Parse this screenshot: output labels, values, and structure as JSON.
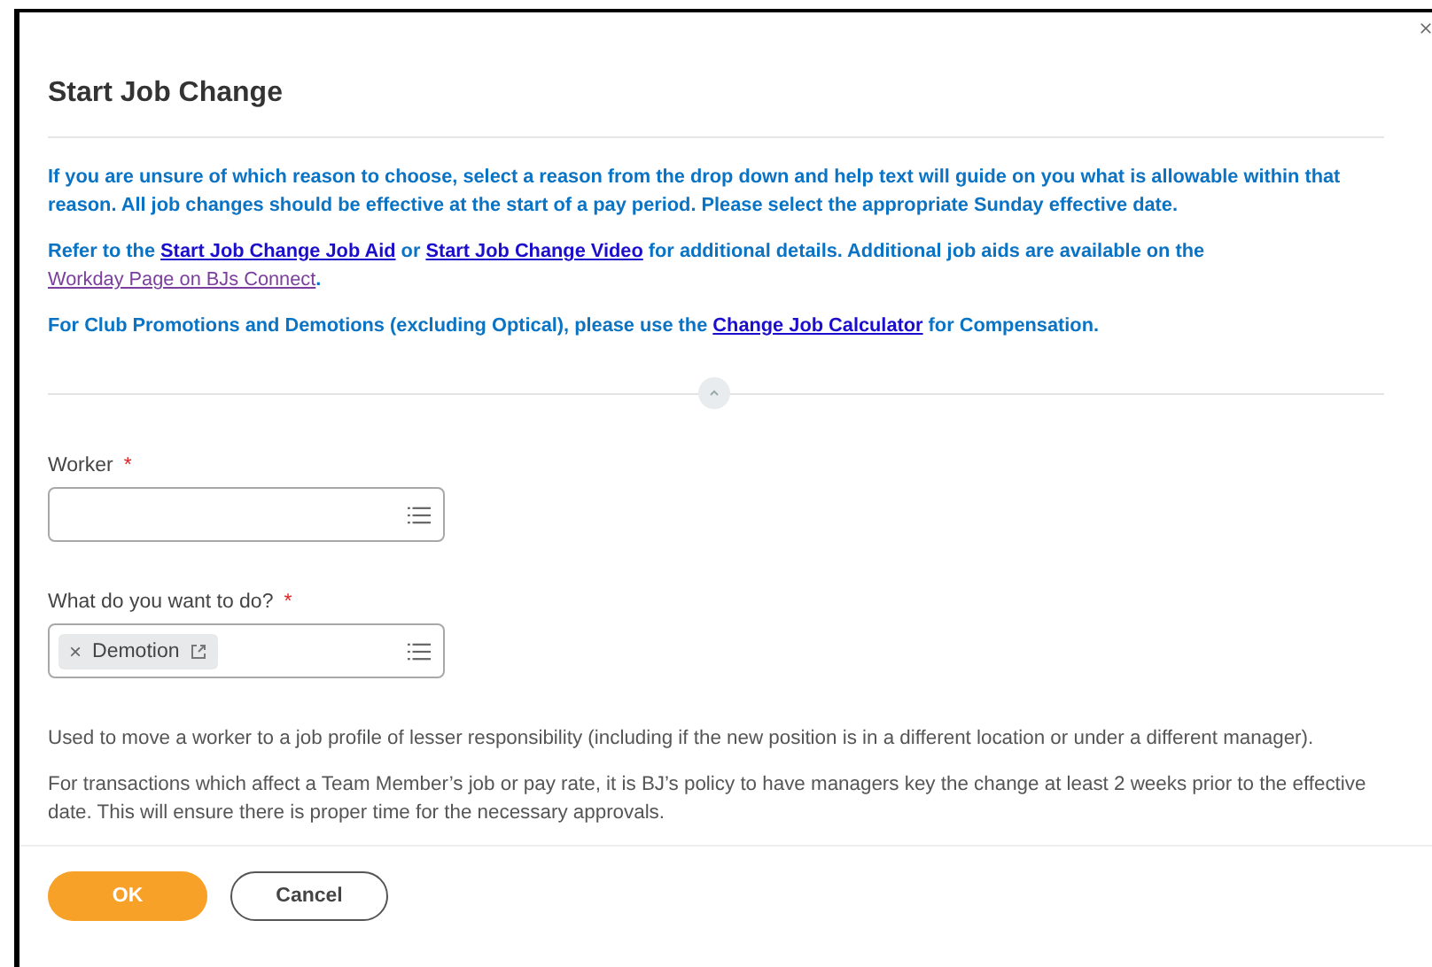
{
  "dialog": {
    "title": "Start Job Change"
  },
  "instructions": [
    [
      {
        "kind": "text",
        "text": "If you are unsure of which reason to choose, select a reason from the drop down and help text will guide on you what is allowable within that reason. All job changes should be effective at the start of a pay period.  Please select the appropriate Sunday effective date."
      }
    ],
    [
      {
        "kind": "text",
        "text": "Refer to the "
      },
      {
        "kind": "link",
        "text": "Start Job Change Job Aid"
      },
      {
        "kind": "text",
        "text": " or "
      },
      {
        "kind": "link",
        "text": "Start Job Change Video"
      },
      {
        "kind": "text",
        "text": " for additional details.  Additional job aids are available on the "
      },
      {
        "kind": "visited_link",
        "text": "Workday Page on BJs Connect"
      },
      {
        "kind": "text",
        "text": "."
      }
    ],
    [
      {
        "kind": "text",
        "text": "For Club Promotions and Demotions (excluding Optical), please use the "
      },
      {
        "kind": "link",
        "text": "Change Job Calculator"
      },
      {
        "kind": "text",
        "text": " for Compensation."
      }
    ]
  ],
  "collapse": {
    "expanded": true
  },
  "fields": [
    {
      "label": "Worker",
      "required_mark": "*"
    },
    {
      "label": "What do you want to do?",
      "required_mark": "*",
      "tokens": [
        {
          "remove": "×",
          "text": "Demotion"
        }
      ]
    }
  ],
  "help": [
    "Used to move a worker to a job profile of lesser responsibility (including if the new position is in a different location or under a different manager).",
    "For transactions which affect a Team Member’s job or pay rate, it is BJ’s policy to have managers key the change at least 2 weeks prior to the effective date.  This will ensure there is proper time for the necessary approvals."
  ],
  "buttons": [
    {
      "label": "OK",
      "kind": "primary"
    },
    {
      "label": "Cancel",
      "kind": "secondary"
    }
  ]
}
